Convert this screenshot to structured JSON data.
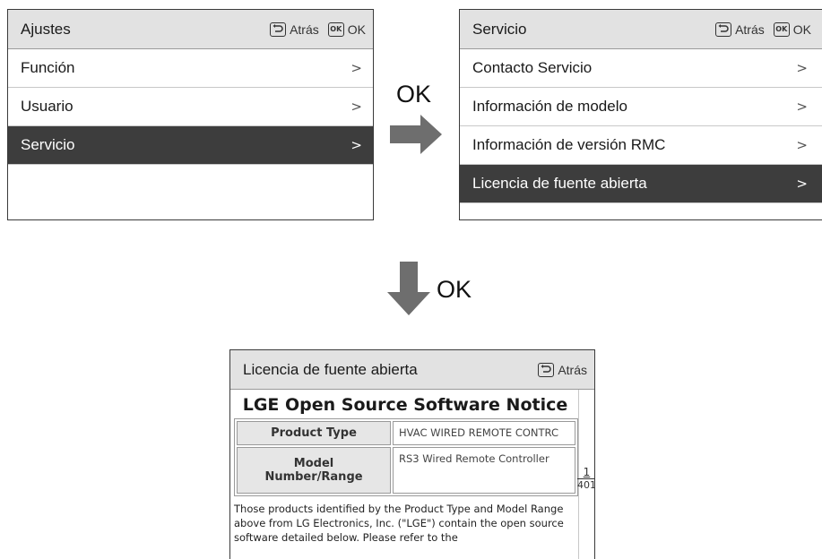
{
  "screen1": {
    "title": "Ajustes",
    "back_label": "Atrás",
    "ok_key": "OK",
    "ok_label": "OK",
    "items": [
      {
        "label": "Función",
        "chevron": ">"
      },
      {
        "label": "Usuario",
        "chevron": ">"
      },
      {
        "label": "Servicio",
        "chevron": ">"
      }
    ]
  },
  "screen2": {
    "title": "Servicio",
    "back_label": "Atrás",
    "ok_key": "OK",
    "ok_label": "OK",
    "items": [
      {
        "label": "Contacto Servicio",
        "chevron": ">"
      },
      {
        "label": "Información de modelo",
        "chevron": ">"
      },
      {
        "label": "Información de versión RMC",
        "chevron": ">"
      },
      {
        "label": "Licencia de fuente abierta",
        "chevron": ">"
      }
    ]
  },
  "screen3": {
    "title": "Licencia de fuente abierta",
    "back_label": "Atrás",
    "notice_title": "LGE Open Source Software Notice",
    "table": [
      {
        "header": "Product Type",
        "value": "HVAC WIRED REMOTE CONTRC"
      },
      {
        "header": "Model Number/Range",
        "value": "RS3 Wired Remote Controller"
      }
    ],
    "paragraph": "Those products identified by the Product Type and Model Range above from LG Electronics, Inc. (\"LGE\") contain the open source software detailed below. Please refer to the",
    "page_current": "1",
    "page_total": "401"
  },
  "arrows": {
    "right_label": "OK",
    "down_label": "OK"
  },
  "colors": {
    "header_bg": "#e2e2e2",
    "selected_bg": "#3d3d3d",
    "arrow": "#6e6e6e"
  }
}
